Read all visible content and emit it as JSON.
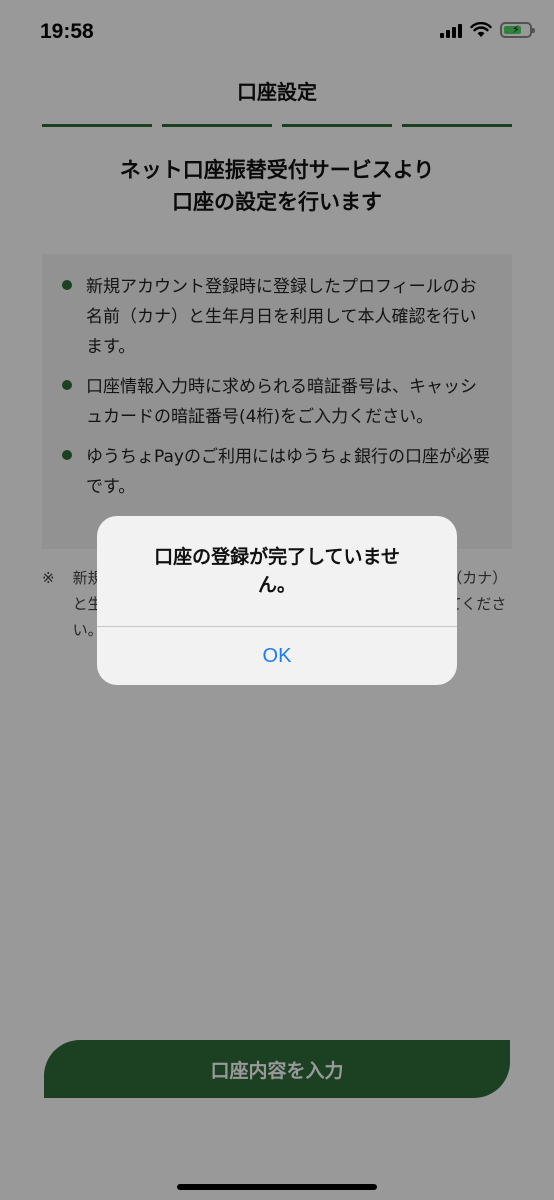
{
  "status_bar": {
    "time": "19:58",
    "icons": [
      "signal-icon",
      "wifi-icon",
      "battery-charging-icon"
    ]
  },
  "header": {
    "title": "口座設定"
  },
  "progress": {
    "steps": 4
  },
  "headline": {
    "line1": "ネット口座振替受付サービスより",
    "line2": "口座の設定を行います"
  },
  "info": {
    "items": [
      "新規アカウント登録時に登録したプロフィールのお名前（カナ）と生年月日を利用して本人確認を行います。",
      "口座情報入力時に求められる暗証番号は、キャッシュカードの暗証番号(4桁)をご入力ください。",
      "ゆうちょPayのご利用にはゆうちょ銀行の口座が必要です。"
    ]
  },
  "notes": {
    "mark": "※",
    "text": "新規アカウント登録時に登録したプロフィールのお名前（カナ）と生年月日が異なる場合は、アプリを再インストールしてください。"
  },
  "primary_button": {
    "label": "口座内容を入力"
  },
  "alert": {
    "message": "口座の登録が完了していません。",
    "ok_label": "OK"
  },
  "colors": {
    "brand_green": "#2e6b3a",
    "ios_blue": "#1d7cf2"
  }
}
